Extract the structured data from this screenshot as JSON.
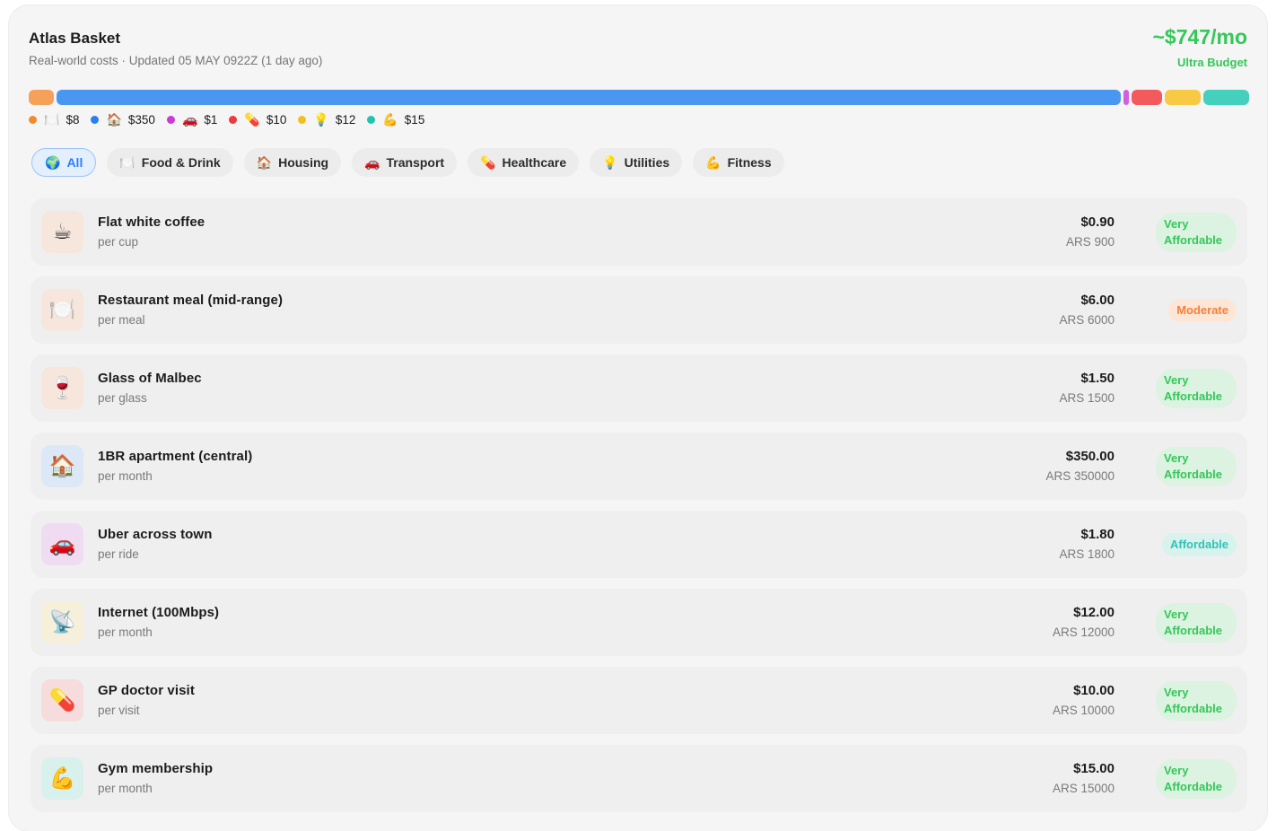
{
  "header": {
    "title": "Atlas Basket",
    "subtitle": "Real-world costs · Updated 05 MAY 0922Z (1 day ago)",
    "total": "~$747/mo",
    "tier": "Ultra Budget"
  },
  "breakdown": {
    "segments": [
      {
        "name": "Food & Drink",
        "value": 8,
        "color": "#f6a15a"
      },
      {
        "name": "Housing",
        "value": 350,
        "color": "#4a97f2"
      },
      {
        "name": "Transport",
        "value": 1,
        "color": "#d35fe0"
      },
      {
        "name": "Healthcare",
        "value": 10,
        "color": "#f25a5e"
      },
      {
        "name": "Utilities",
        "value": 12,
        "color": "#f8c945"
      },
      {
        "name": "Fitness",
        "value": 15,
        "color": "#45d0bd"
      }
    ],
    "legend": [
      {
        "dot": "#f38a30",
        "emoji": "🍽️",
        "label": "$8"
      },
      {
        "dot": "#2a7ff0",
        "emoji": "🏠",
        "label": "$350"
      },
      {
        "dot": "#c93ad8",
        "emoji": "🚗",
        "label": "$1"
      },
      {
        "dot": "#ee3a3a",
        "emoji": "💊",
        "label": "$10"
      },
      {
        "dot": "#f4be1c",
        "emoji": "💡",
        "label": "$12"
      },
      {
        "dot": "#1fc4ad",
        "emoji": "💪",
        "label": "$15"
      }
    ]
  },
  "filters": [
    {
      "emoji": "🌍",
      "label": "All",
      "active": true
    },
    {
      "emoji": "🍽️",
      "label": "Food & Drink"
    },
    {
      "emoji": "🏠",
      "label": "Housing"
    },
    {
      "emoji": "🚗",
      "label": "Transport"
    },
    {
      "emoji": "💊",
      "label": "Healthcare"
    },
    {
      "emoji": "💡",
      "label": "Utilities"
    },
    {
      "emoji": "💪",
      "label": "Fitness"
    }
  ],
  "items": [
    {
      "emoji": "☕",
      "icon_bg": "#f6e6dc",
      "name": "Flat white coffee",
      "unit": "per cup",
      "usd": "$0.90",
      "ars": "ARS 900",
      "badge": "Very Affordable",
      "badge_type": "va"
    },
    {
      "emoji": "🍽️",
      "icon_bg": "#f6e6dc",
      "name": "Restaurant meal (mid-range)",
      "unit": "per meal",
      "usd": "$6.00",
      "ars": "ARS 6000",
      "badge": "Moderate",
      "badge_type": "mod"
    },
    {
      "emoji": "🍷",
      "icon_bg": "#f6e6dc",
      "name": "Glass of Malbec",
      "unit": "per glass",
      "usd": "$1.50",
      "ars": "ARS 1500",
      "badge": "Very Affordable",
      "badge_type": "va"
    },
    {
      "emoji": "🏠",
      "icon_bg": "#dde8f6",
      "name": "1BR apartment (central)",
      "unit": "per month",
      "usd": "$350.00",
      "ars": "ARS 350000",
      "badge": "Very Affordable",
      "badge_type": "va"
    },
    {
      "emoji": "🚗",
      "icon_bg": "#efdcf3",
      "name": "Uber across town",
      "unit": "per ride",
      "usd": "$1.80",
      "ars": "ARS 1800",
      "badge": "Affordable",
      "badge_type": "aff"
    },
    {
      "emoji": "📡",
      "icon_bg": "#f6efd9",
      "name": "Internet (100Mbps)",
      "unit": "per month",
      "usd": "$12.00",
      "ars": "ARS 12000",
      "badge": "Very Affordable",
      "badge_type": "va"
    },
    {
      "emoji": "💊",
      "icon_bg": "#f6dcdc",
      "name": "GP doctor visit",
      "unit": "per visit",
      "usd": "$10.00",
      "ars": "ARS 10000",
      "badge": "Very Affordable",
      "badge_type": "va"
    },
    {
      "emoji": "💪",
      "icon_bg": "#d9f1ec",
      "name": "Gym membership",
      "unit": "per month",
      "usd": "$15.00",
      "ars": "ARS 15000",
      "badge": "Very Affordable",
      "badge_type": "va"
    }
  ]
}
